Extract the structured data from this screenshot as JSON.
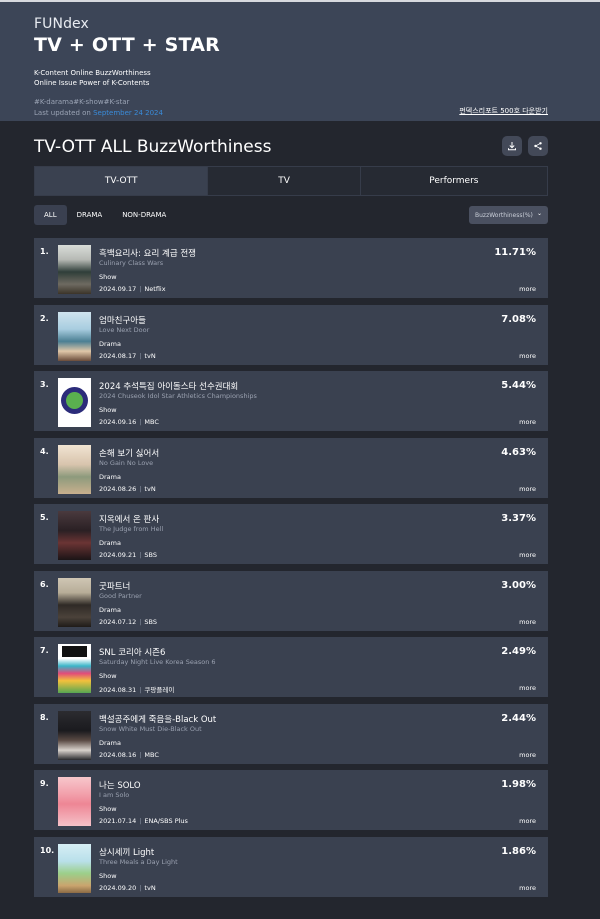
{
  "header": {
    "brand": "FUNdex",
    "title": "TV + OTT + STAR",
    "desc_line1": "K-Content Online BuzzWorthiness",
    "desc_line2": "Online Issue Power of K-Contents",
    "tags": "#K-darama#K-show#K-star",
    "updated_label": "Last updated on",
    "updated_date": "September 24 2024",
    "report_link": "펀덱스리포트 500호 다운받기"
  },
  "section": {
    "title": "TV-OTT ALL BuzzWorthiness",
    "download_icon": "download-icon",
    "share_icon": "share-icon"
  },
  "tabs": [
    "TV-OTT",
    "TV",
    "Performers"
  ],
  "active_tab": 0,
  "filters": [
    "ALL",
    "DRAMA",
    "NON-DRAMA"
  ],
  "active_filter": 0,
  "sort": {
    "label": "BuzzWorthiness(%)",
    "icon": "chevron-down-icon"
  },
  "more_label": "more",
  "items": [
    {
      "rank": "1.",
      "name_ko": "흑백요리사: 요리 계급 전쟁",
      "name_en": "Culinary Class Wars",
      "genre": "Show",
      "date": "2024.09.17",
      "channel": "Netflix",
      "pct": "11.71%"
    },
    {
      "rank": "2.",
      "name_ko": "엄마친구아들",
      "name_en": "Love Next Door",
      "genre": "Drama",
      "date": "2024.08.17",
      "channel": "tvN",
      "pct": "7.08%"
    },
    {
      "rank": "3.",
      "name_ko": "2024 추석특집 아이돌스타 선수권대회",
      "name_en": "2024 Chuseok Idol Star Athletics Championships",
      "genre": "Show",
      "date": "2024.09.16",
      "channel": "MBC",
      "pct": "5.44%"
    },
    {
      "rank": "4.",
      "name_ko": "손해 보기 싫어서",
      "name_en": "No Gain No Love",
      "genre": "Drama",
      "date": "2024.08.26",
      "channel": "tvN",
      "pct": "4.63%"
    },
    {
      "rank": "5.",
      "name_ko": "지옥에서 온 판사",
      "name_en": "The Judge from Hell",
      "genre": "Drama",
      "date": "2024.09.21",
      "channel": "SBS",
      "pct": "3.37%"
    },
    {
      "rank": "6.",
      "name_ko": "굿파트너",
      "name_en": "Good Partner",
      "genre": "Drama",
      "date": "2024.07.12",
      "channel": "SBS",
      "pct": "3.00%"
    },
    {
      "rank": "7.",
      "name_ko": "SNL 코리아 시즌6",
      "name_en": "Saturday Night Live Korea Season 6",
      "genre": "Show",
      "date": "2024.08.31",
      "channel": "쿠팡플레이",
      "pct": "2.49%"
    },
    {
      "rank": "8.",
      "name_ko": "백설공주에게 죽음을-Black Out",
      "name_en": "Snow White Must Die-Black Out",
      "genre": "Drama",
      "date": "2024.08.16",
      "channel": "MBC",
      "pct": "2.44%"
    },
    {
      "rank": "9.",
      "name_ko": "나는 SOLO",
      "name_en": "I am Solo",
      "genre": "Show",
      "date": "2021.07.14",
      "channel": "ENA/SBS Plus",
      "pct": "1.98%"
    },
    {
      "rank": "10.",
      "name_ko": "삼시세끼 Light",
      "name_en": "Three Meals a Day Light",
      "genre": "Show",
      "date": "2024.09.20",
      "channel": "tvN",
      "pct": "1.86%"
    }
  ]
}
